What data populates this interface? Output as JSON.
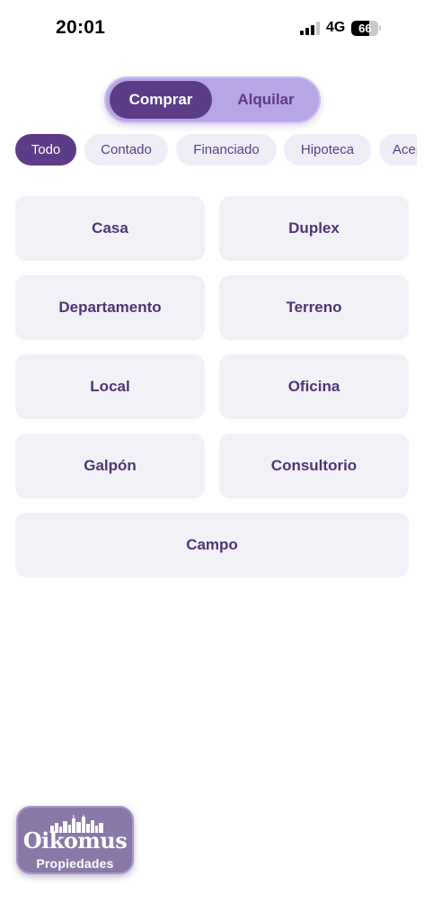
{
  "status_bar": {
    "time": "20:01",
    "network": "4G",
    "battery_level": "66",
    "signal_icon": "signal-bars-icon"
  },
  "segment": {
    "options": [
      "Comprar",
      "Alquilar"
    ],
    "selected": "Comprar"
  },
  "filters": {
    "chips": [
      "Todo",
      "Contado",
      "Financiado",
      "Hipoteca",
      "Acepta permuta"
    ],
    "selected": "Todo"
  },
  "property_types": [
    "Casa",
    "Duplex",
    "Departamento",
    "Terreno",
    "Local",
    "Oficina",
    "Galpón",
    "Consultorio",
    "Campo"
  ],
  "logo": {
    "name": "Oikomus",
    "subtitle": "Propiedades",
    "icon": "city-skyline-icon"
  },
  "colors": {
    "primary": "#5c3b87",
    "segment_bg": "#b8a5e3",
    "chip_bg": "#efedf6",
    "card_bg": "#f2f1f7",
    "logo_bg": "#8a78a8"
  }
}
